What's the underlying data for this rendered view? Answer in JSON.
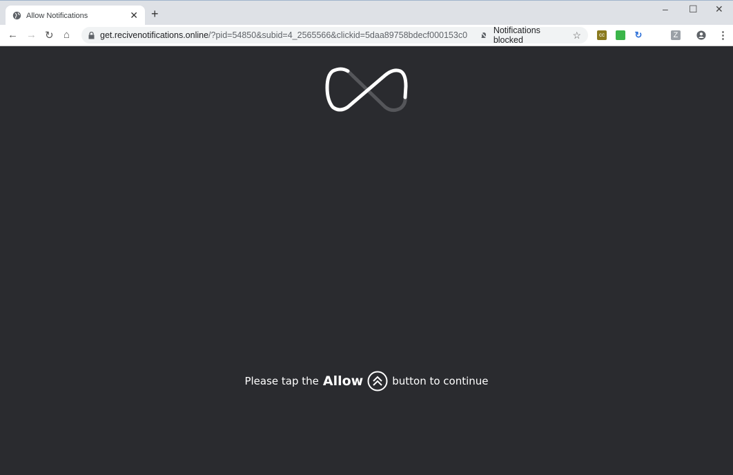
{
  "tab": {
    "title": "Allow Notifications",
    "icon": "globe-icon"
  },
  "address": {
    "url_host": "get.recivenotifications.online",
    "url_rest": "/?pid=54850&subid=4_2565566&clickid=5daa89758bdecf000153c0c2...",
    "notifications_status": "Notifications blocked"
  },
  "content": {
    "msg_before": "Please tap the",
    "msg_bold": "Allow",
    "msg_after": "button to continue"
  },
  "colors": {
    "page_bg": "#2a2b2f",
    "tabstrip": "#dee1e6"
  }
}
